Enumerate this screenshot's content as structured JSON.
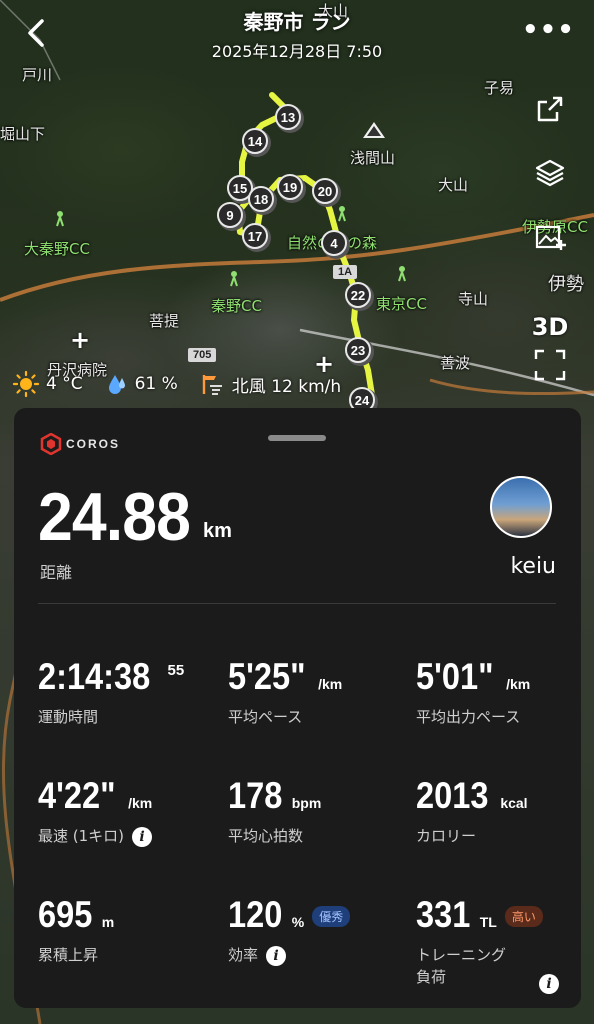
{
  "header": {
    "title": "秦野市 ラン",
    "datetime": "2025年12月28日 7:50"
  },
  "map": {
    "places": {
      "tokawa": "戸川",
      "nishiyamashita": "堀山下",
      "koeki": "子易",
      "oyama_top": "大山",
      "sengenyama": "浅間山",
      "oyama": "大山",
      "shizen": "自然の家の森",
      "ohadano_cc": "大秦野CC",
      "hadano_cc": "秦野CC",
      "tokyo_cc": "東京CC",
      "terayama": "寺山",
      "bodai": "菩提",
      "tanzawa_hospital": "丹沢病院",
      "zennami": "善波",
      "isehara_cc": "伊勢原CC",
      "ise": "伊勢"
    },
    "road_sign_705": "705",
    "road_sign_1a": "1A",
    "waypoints": [
      "13",
      "14",
      "15",
      "18",
      "19",
      "20",
      "9",
      "17",
      "4",
      "22",
      "23",
      "24"
    ],
    "route_color": "#e6f542"
  },
  "side_buttons": {
    "share": "share-icon",
    "layers": "layers-icon",
    "image": "add-image-icon",
    "three_d": "3D",
    "fullscreen": "fullscreen-icon"
  },
  "weather": {
    "temp": "4 °C",
    "humidity": "61 %",
    "wind": "北風 12 km/h"
  },
  "card": {
    "brand": "COROS",
    "distance": {
      "value": "24.88",
      "unit": "km",
      "label": "距離"
    },
    "username": "keiu",
    "metrics": [
      {
        "value": "2:14:38",
        "sup": "55",
        "unit": "",
        "label": "運動時間"
      },
      {
        "value": "5'25\"",
        "unit": "/km",
        "label": "平均ペース"
      },
      {
        "value": "5'01\"",
        "unit": "/km",
        "label": "平均出力ペース"
      },
      {
        "value": "4'22\"",
        "unit": "/km",
        "label": "最速 (1キロ)"
      },
      {
        "value": "178",
        "unit": "bpm",
        "label": "平均心拍数"
      },
      {
        "value": "2013",
        "unit": "kcal",
        "label": "カロリー"
      },
      {
        "value": "695",
        "unit": "m",
        "label": "累積上昇"
      },
      {
        "value": "120",
        "unit": "%",
        "badge": "優秀",
        "label": "効率"
      },
      {
        "value": "331",
        "unit": "TL",
        "badge": "高い",
        "label": "トレーニング\n負荷"
      }
    ],
    "colors": {
      "badge_good": "#1f3f7a",
      "badge_high": "#5a2a1a"
    }
  }
}
